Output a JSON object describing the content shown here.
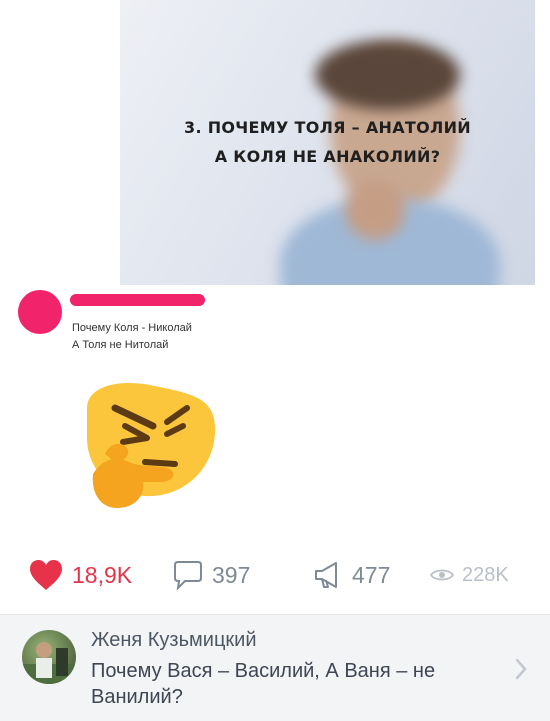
{
  "meme": {
    "line1": "3. ПОЧЕМУ ТОЛЯ – АНАТОЛИЙ",
    "line2": "А КОЛЯ НЕ АНАКОЛИЙ?"
  },
  "comment": {
    "line1": "Почему Коля - Николай",
    "line2": "А Толя не Нитолай",
    "emoji": "thinking-face-icon"
  },
  "stats": {
    "likes": "18,9K",
    "comments": "397",
    "reposts": "477",
    "views": "228K"
  },
  "reply": {
    "author": "Женя Кузьмицкий",
    "text": "Почему Вася – Василий, А Ваня – не Ванилий?"
  },
  "colors": {
    "like": "#e6334a",
    "redaction": "#f0236b",
    "icon_gray": "#7f8a96",
    "emoji_face": "#fbc53c",
    "emoji_hand": "#f4a41f"
  }
}
